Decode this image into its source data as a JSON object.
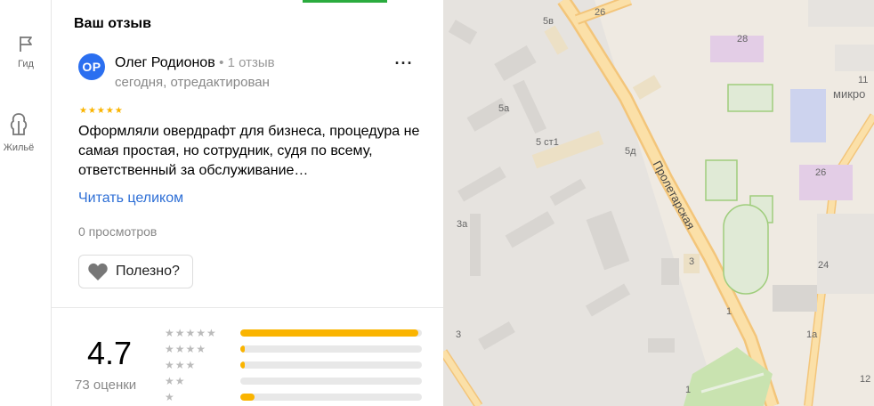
{
  "rail": {
    "items": [
      {
        "label": "Гид",
        "icon": "flag-icon"
      },
      {
        "label": "Жильё",
        "icon": "apartment-icon"
      }
    ]
  },
  "review": {
    "section_title": "Ваш отзыв",
    "avatar_initials": "OP",
    "author_name": "Олег Родионов",
    "author_meta": "• 1 отзыв",
    "date_status": "сегодня, отредактирован",
    "stars_display": "★★★★★",
    "text": "Оформляли овердрафт для бизнеса, процедура не самая простая, но сотрудник, судя по всему, ответственный за обслуживание…",
    "read_more": "Читать целиком",
    "views": "0 просмотров",
    "useful_label": "Полезно?"
  },
  "rating": {
    "value": "4.7",
    "count_label": "73 оценки",
    "distribution": [
      {
        "stars": "★★★★★",
        "share": 0.98
      },
      {
        "stars": "★★★★",
        "share": 0.02
      },
      {
        "stars": "★★★",
        "share": 0.02
      },
      {
        "stars": "★★",
        "share": 0.0
      },
      {
        "stars": "★",
        "share": 0.08
      }
    ]
  },
  "map": {
    "street_name": "Пролетарская",
    "labels": [
      "26",
      "5в",
      "28",
      "11",
      "микро",
      "5а",
      "5 ст1",
      "5д",
      "26",
      "3а",
      "24",
      "3",
      "3",
      "1",
      "1а",
      "1",
      "12"
    ]
  },
  "colors": {
    "accent_blue": "#2e6fd6",
    "star_yellow": "#fab400",
    "avatar_blue": "#2b6ff0",
    "top_green": "#2aab3e"
  }
}
